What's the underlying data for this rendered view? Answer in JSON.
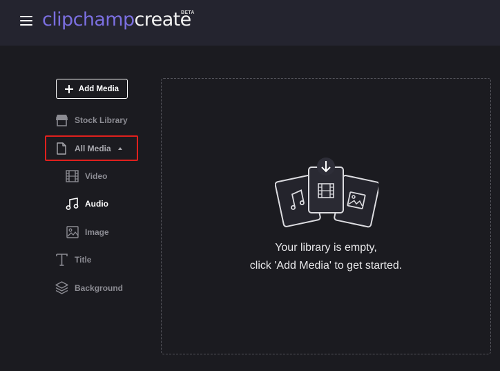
{
  "header": {
    "brand": "clipchamp",
    "product": "create",
    "badge": "BETA"
  },
  "sidebar": {
    "add_media_label": "Add Media",
    "items": [
      {
        "label": "Stock Library",
        "icon": "store-icon"
      },
      {
        "label": "All Media",
        "icon": "file-icon",
        "expanded": true,
        "highlighted": true
      },
      {
        "label": "Video",
        "icon": "film-icon"
      },
      {
        "label": "Audio",
        "icon": "music-note-icon",
        "selected": true
      },
      {
        "label": "Image",
        "icon": "image-icon"
      },
      {
        "label": "Title",
        "icon": "text-icon"
      },
      {
        "label": "Background",
        "icon": "layers-icon"
      }
    ]
  },
  "library": {
    "empty_line1": "Your library is empty,",
    "empty_line2": "click 'Add Media' to get started."
  },
  "colors": {
    "header_bg": "#24242f",
    "page_bg": "#1b1b20",
    "brand": "#7b6fe0",
    "highlight": "#e0201d",
    "muted_text": "#8c8c93"
  }
}
